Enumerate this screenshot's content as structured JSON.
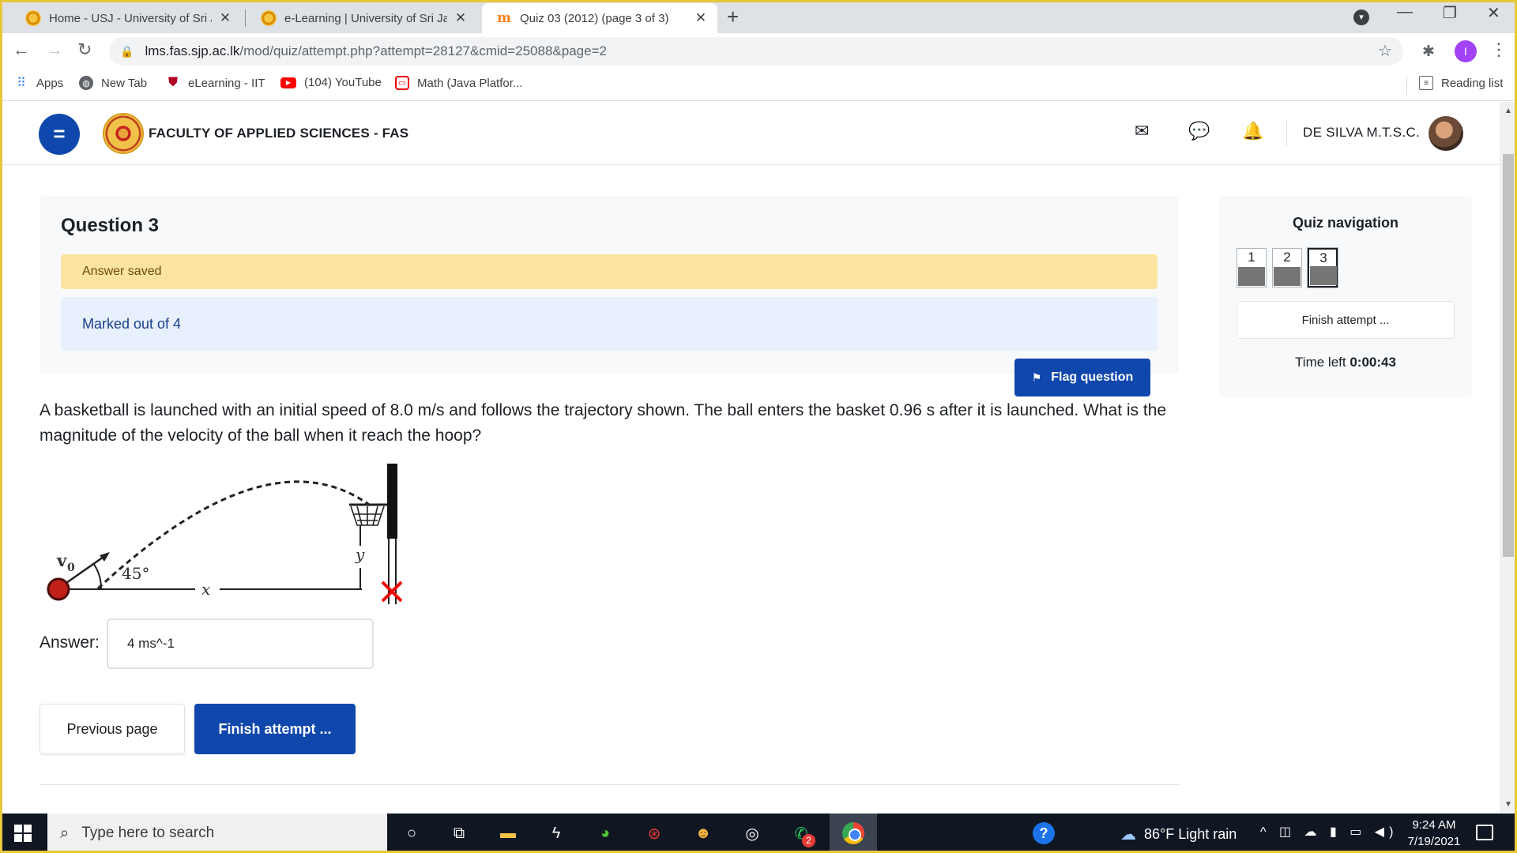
{
  "browser": {
    "tabs": [
      {
        "title": "Home - USJ - University of Sri Jay",
        "close": "✕",
        "active": false
      },
      {
        "title": "e-Learning | University of Sri Jaye",
        "close": "✕",
        "active": false
      },
      {
        "title": "Quiz 03 (2012) (page 3 of 3)",
        "close": "✕",
        "active": true
      }
    ],
    "new_tab": "+",
    "url_host": "lms.fas.sjp.ac.lk",
    "url_path": "/mod/quiz/attempt.php?attempt=28127&cmid=25088&page=2",
    "profile_initial": "I",
    "bookmarks": [
      {
        "label": "Apps",
        "icon": "apps-grid-icon"
      },
      {
        "label": "New Tab",
        "icon": "globe-icon"
      },
      {
        "label": "eLearning - IIT",
        "icon": "shield-icon"
      },
      {
        "label": "(104) YouTube",
        "icon": "youtube-icon"
      },
      {
        "label": "Math (Java Platfor...",
        "icon": "math-icon"
      }
    ],
    "reading_list": "Reading list"
  },
  "header": {
    "brand": "FACULTY OF APPLIED SCIENCES - FAS",
    "user_name": "DE SILVA M.T.S.C."
  },
  "question": {
    "number_label": "Question 3",
    "state": "Answer saved",
    "grade": "Marked out of 4",
    "flag_label": "Flag question",
    "text": "A basketball is launched with an initial speed of 8.0 m/s and follows the trajectory shown. The ball enters the basket 0.96 s after it is launched. What is the magnitude of the velocity of the ball when it reach the hoop?",
    "diagram": {
      "v0_label": "v",
      "v0_sub": "0",
      "angle_label": "45°",
      "x_label": "x",
      "y_label": "y"
    },
    "answer_label": "Answer:",
    "answer_value": "4 ms^-1"
  },
  "actions": {
    "previous": "Previous page",
    "finish": "Finish attempt ..."
  },
  "quiz_nav": {
    "title": "Quiz navigation",
    "questions": [
      "1",
      "2",
      "3"
    ],
    "current": 3,
    "finish": "Finish attempt ...",
    "time_label": "Time left",
    "time_value": "0:00:43"
  },
  "taskbar": {
    "search_placeholder": "Type here to search",
    "weather": "86°F  Light rain",
    "time": "9:24 AM",
    "date": "7/19/2021",
    "whatsapp_badge": "2"
  },
  "colors": {
    "primary": "#0f47ad",
    "state_bg": "#fbe4a0",
    "grade_bg": "#e7f0fc",
    "frame": "#e8c83a"
  }
}
